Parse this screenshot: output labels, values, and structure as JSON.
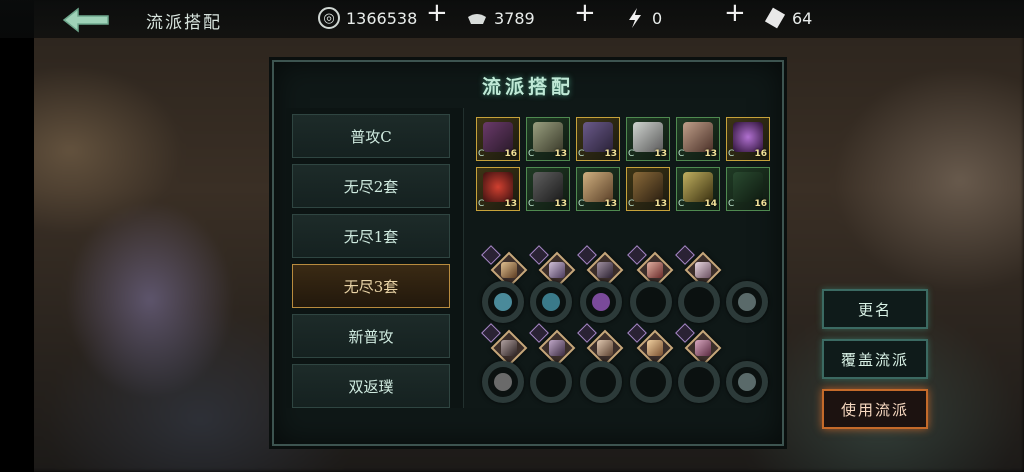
{
  "header": {
    "title": "流派搭配",
    "resources": [
      {
        "icon": "silver-coin-icon",
        "value": "1366538"
      },
      {
        "icon": "ingot-icon",
        "value": "3789"
      },
      {
        "icon": "lightning-icon",
        "value": "0"
      },
      {
        "icon": "ticket-icon",
        "value": "64"
      }
    ]
  },
  "panel": {
    "title": "流派搭配",
    "builds": [
      {
        "label": "普攻C",
        "active": false
      },
      {
        "label": "无尽2套",
        "active": false
      },
      {
        "label": "无尽1套",
        "active": false
      },
      {
        "label": "无尽3套",
        "active": true
      },
      {
        "label": "新普攻",
        "active": false
      },
      {
        "label": "双返璞",
        "active": false
      }
    ],
    "equipment": [
      {
        "level": "16",
        "quality": "gold"
      },
      {
        "level": "13",
        "quality": "green"
      },
      {
        "level": "13",
        "quality": "gold"
      },
      {
        "level": "13",
        "quality": "green"
      },
      {
        "level": "13",
        "quality": "green"
      },
      {
        "level": "16",
        "quality": "gold"
      },
      {
        "level": "13",
        "quality": "gold"
      },
      {
        "level": "13",
        "quality": "green"
      },
      {
        "level": "13",
        "quality": "green"
      },
      {
        "level": "13",
        "quality": "gold"
      },
      {
        "level": "14",
        "quality": "green"
      },
      {
        "level": "16",
        "quality": "green"
      }
    ]
  },
  "actions": {
    "rename": "更名",
    "overwrite": "覆盖流派",
    "use": "使用流派"
  },
  "colors": {
    "accent": "#3b6a62",
    "active": "#b88b3e",
    "use": "#c46a2a"
  }
}
